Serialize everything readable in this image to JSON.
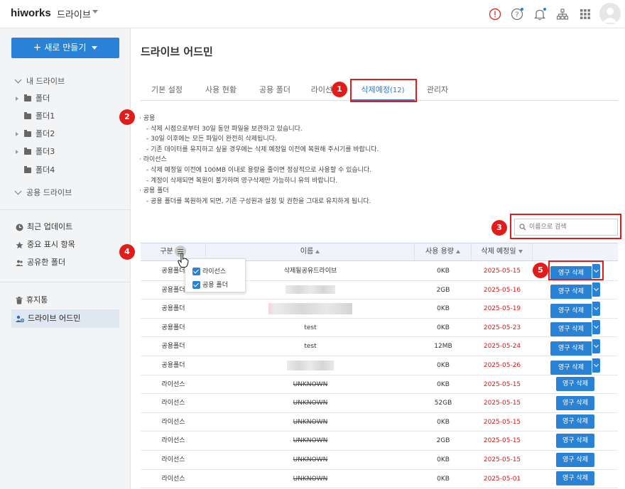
{
  "header": {
    "brand": "hiworks",
    "app_name": "드라이브",
    "icons": [
      "alert-icon",
      "help-icon",
      "bell-icon",
      "org-chart-icon",
      "apps-grid-icon",
      "avatar"
    ]
  },
  "sidebar": {
    "new_button": "새로 만들기",
    "my_drive": "내 드라이브",
    "folders": [
      {
        "label": "폴더",
        "expandable": true
      },
      {
        "label": "폴더1",
        "expandable": false
      },
      {
        "label": "폴더2",
        "expandable": true
      },
      {
        "label": "폴더3",
        "expandable": true
      },
      {
        "label": "폴더4",
        "expandable": false
      }
    ],
    "shared_drive": "공용 드라이브",
    "items": [
      {
        "label": "최근 업데이트"
      },
      {
        "label": "중요 표시 항목"
      },
      {
        "label": "공유한 폴더"
      }
    ],
    "trash": "휴지통",
    "drive_admin": "드라이브 어드민"
  },
  "main": {
    "title": "드라이브 어드민",
    "tabs": [
      {
        "label": "기본 설정"
      },
      {
        "label": "사용 현황"
      },
      {
        "label": "공용 폴더"
      },
      {
        "label": "라이선스"
      },
      {
        "label": "삭제예정",
        "count": "(12)"
      },
      {
        "label": "관리자"
      }
    ],
    "notes": [
      {
        "type": "h",
        "text": "· 공용"
      },
      {
        "type": "d",
        "text": "- 삭제 시점으로부터 30일 동안 파일을 보관하고 있습니다."
      },
      {
        "type": "d",
        "text": "- 30일 이후에는 모든 파일이 완전히 삭제됩니다."
      },
      {
        "type": "d",
        "text": "- 기존 데이터를 유지하고 싶을 경우에는 삭제 예정일 이전에 복원해 주시기를 바랍니다."
      },
      {
        "type": "h",
        "text": "· 라이선스"
      },
      {
        "type": "d",
        "text": "- 삭제 예정일 이전에 100MB 이내로 용량을 줄이면 정상적으로 사용할 수 있습니다."
      },
      {
        "type": "d",
        "text": "- 계정이 삭제되면 복원이 불가하며 영구삭제만 가능하니 유의 바랍니다."
      },
      {
        "type": "h",
        "text": "· 공용 폴더"
      },
      {
        "type": "d",
        "text": "- 공용 폴더를 복원하게 되면, 기존 구성원과 설정 및 권한을 그대로 유지하게 됩니다."
      }
    ],
    "search_placeholder": "이름으로 검색",
    "markers": [
      "1",
      "2",
      "3",
      "4",
      "5"
    ],
    "table": {
      "headers": {
        "type": "구분",
        "name": "이름",
        "size": "사용 용량",
        "date": "삭제 예정일"
      },
      "column_menu": [
        "라이선스",
        "공용 폴더"
      ],
      "delete_label": "영구 삭제",
      "rows": [
        {
          "type": "공용폴더",
          "name": "삭제될공유드라이브",
          "name_style": "text",
          "size": "0KB",
          "date": "2025-05-15",
          "dropdown": true
        },
        {
          "type": "공용폴더",
          "name": "",
          "name_style": "blur",
          "size": "2GB",
          "date": "2025-05-16",
          "dropdown": true
        },
        {
          "type": "공용폴더",
          "name": "",
          "name_style": "blur-pink",
          "size": "0KB",
          "date": "2025-05-19",
          "dropdown": true
        },
        {
          "type": "공용폴더",
          "name": "test",
          "name_style": "text",
          "size": "0KB",
          "date": "2025-05-23",
          "dropdown": true
        },
        {
          "type": "공용폴더",
          "name": "test",
          "name_style": "text",
          "size": "12MB",
          "date": "2025-05-24",
          "dropdown": true
        },
        {
          "type": "공용폴더",
          "name": "",
          "name_style": "blur-small",
          "size": "0KB",
          "date": "2025-05-26",
          "dropdown": true
        },
        {
          "type": "라이선스",
          "name": "UNKNOWN",
          "name_style": "strike",
          "size": "0KB",
          "date": "2025-05-15",
          "dropdown": false
        },
        {
          "type": "라이선스",
          "name": "UNKNOWN",
          "name_style": "strike",
          "size": "52GB",
          "date": "2025-05-15",
          "dropdown": false
        },
        {
          "type": "라이선스",
          "name": "UNKNOWN",
          "name_style": "strike",
          "size": "0KB",
          "date": "2025-05-15",
          "dropdown": false
        },
        {
          "type": "라이선스",
          "name": "UNKNOWN",
          "name_style": "strike",
          "size": "2GB",
          "date": "2025-05-15",
          "dropdown": false
        },
        {
          "type": "라이선스",
          "name": "UNKNOWN",
          "name_style": "strike",
          "size": "0KB",
          "date": "2025-05-15",
          "dropdown": false
        },
        {
          "type": "라이선스",
          "name": "UNKNOWN",
          "name_style": "strike",
          "size": "0KB",
          "date": "2025-05-01",
          "dropdown": false
        }
      ]
    }
  },
  "colors": {
    "accent": "#2a82d6",
    "highlight": "#e21b1b",
    "date": "#d11a1a"
  }
}
